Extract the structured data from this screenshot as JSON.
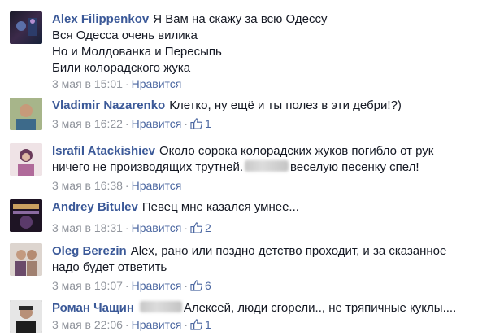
{
  "comments": [
    {
      "author": "Alex Filippenkov",
      "lines": [
        "Я Вам на скажу за всю Одессу",
        "Вся Одесса очень вилика",
        "Но и Молдованка и Пересыпь",
        "Били колорадского жука"
      ],
      "date": "3 мая в 15:01",
      "like_label": "Нравится",
      "likes": ""
    },
    {
      "author": "Vladimir Nazarenko",
      "lines": [
        "Клетко, ну ещё и ты полез в эти дебри!?)"
      ],
      "date": "3 мая в 16:22",
      "like_label": "Нравится",
      "likes": "1"
    },
    {
      "author": "Israfil Atackishiev",
      "lines": [
        "Около сорока колорадских жуков погибло от рук",
        "ничего не производящих трутней.",
        "веселую песенку спел!"
      ],
      "date": "3 мая в 16:38",
      "like_label": "Нравится",
      "likes": ""
    },
    {
      "author": "Andrey Bitulev",
      "lines": [
        "Певец мне казался умнее..."
      ],
      "date": "3 мая в 18:31",
      "like_label": "Нравится",
      "likes": "2"
    },
    {
      "author": "Oleg Berezin",
      "lines": [
        "Alex, рано или поздно детство проходит, и за сказанное",
        "надо будет ответить"
      ],
      "date": "3 мая в 19:07",
      "like_label": "Нравится",
      "likes": "6"
    },
    {
      "author": "Роман Чащин",
      "lines": [
        "Алексей, люди сгорели.., не тряпичные куклы...."
      ],
      "date": "3 мая в 22:06",
      "like_label": "Нравится",
      "likes": "1"
    }
  ],
  "colors": {
    "author": "#3b5998",
    "meta": "#90949c",
    "link": "#4b67a1",
    "text": "#141823"
  },
  "icons": {
    "like": "thumbs-up-icon"
  }
}
